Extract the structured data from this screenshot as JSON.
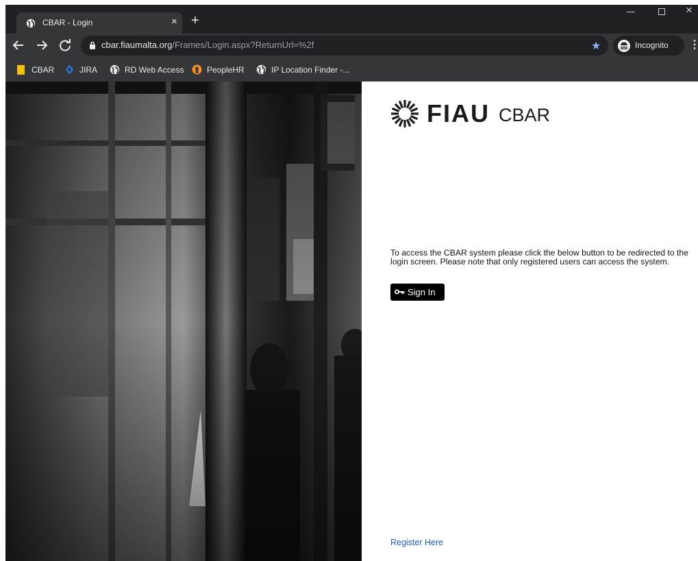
{
  "browser": {
    "tab_title": "CBAR - Login",
    "tab_close": "×",
    "new_tab": "+",
    "url_host": "cbar.fiaumalta.org",
    "url_path": "/Frames/Login.aspx?ReturnUrl=%2f",
    "incognito_label": "Incognito",
    "window_close": "×",
    "menu_dots": "⋮"
  },
  "bookmarks": [
    {
      "label": "CBAR",
      "icon": "folder-icon"
    },
    {
      "label": "JIRA",
      "icon": "jira-icon"
    },
    {
      "label": "RD Web Access",
      "icon": "globe-icon"
    },
    {
      "label": "PeopleHR",
      "icon": "peoplehr-icon"
    },
    {
      "label": "IP Location Finder -...",
      "icon": "globe-icon"
    }
  ],
  "page": {
    "logo_text": "FIAU",
    "product_name": "CBAR",
    "intro_text": "To access the CBAR system please click the below button to be redirected to the login screen. Please note that only registered users can access the system.",
    "signin_label": "Sign In",
    "register_link": "Register Here"
  },
  "colors": {
    "chrome_dark": "#202124",
    "chrome_toolbar": "#35363a",
    "star": "#8ab4f8",
    "link": "#1a5fb4",
    "button": "#000000"
  }
}
